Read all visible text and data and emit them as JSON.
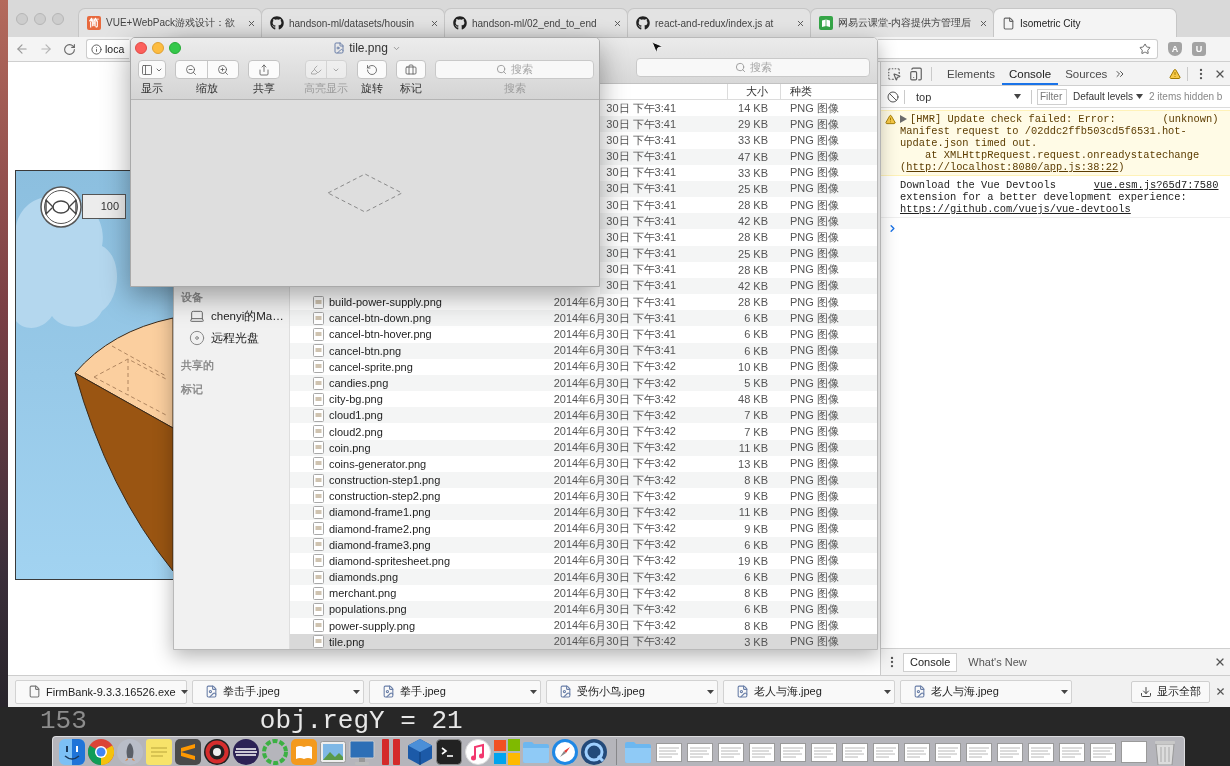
{
  "browser": {
    "tabs": [
      {
        "kind": "letter",
        "icon_text": "简",
        "title": "VUE+WebPack游戏设计：欲",
        "selected": false
      },
      {
        "kind": "github",
        "title": "handson-ml/datasets/housin",
        "selected": false
      },
      {
        "kind": "github",
        "title": "handson-ml/02_end_to_end",
        "selected": false
      },
      {
        "kind": "github",
        "title": "react-and-redux/index.js at",
        "selected": false
      },
      {
        "kind": "book",
        "title": "网易云课堂-内容提供方管理后",
        "selected": false
      },
      {
        "kind": "page",
        "title": "Isometric City",
        "selected": true
      }
    ],
    "address": {
      "value": "loca"
    },
    "extensions": [
      "A",
      "U"
    ]
  },
  "page": {
    "counter": "100"
  },
  "preview": {
    "title": "tile.png",
    "toolbar": [
      {
        "kind": "menu",
        "label": "显示",
        "disabled": false
      },
      {
        "kind": "pair",
        "label": "缩放",
        "disabled": false
      },
      {
        "kind": "button",
        "label": "共享",
        "disabled": false
      },
      {
        "kind": "split",
        "label": "高亮显示",
        "disabled": true
      },
      {
        "kind": "button",
        "label": "旋转",
        "disabled": false
      },
      {
        "kind": "button",
        "label": "标记",
        "disabled": false
      },
      {
        "kind": "search",
        "label": "搜索",
        "placeholder": "搜索",
        "disabled": false
      }
    ]
  },
  "finder": {
    "search": {
      "placeholder": "搜索"
    },
    "columns": [
      "大小",
      "种类"
    ],
    "sidebar": [
      {
        "title": "设备",
        "items": [
          {
            "kind": "computer",
            "label": "chenyi的Ma…"
          },
          {
            "kind": "disc",
            "label": "远程光盘"
          }
        ]
      },
      {
        "title": "共享的"
      },
      {
        "title": "标记"
      }
    ],
    "rows": [
      {
        "modified": "30日 下午3:41",
        "size": "14 KB",
        "type": "PNG 图像",
        "selected": false
      },
      {
        "modified": "30日 下午3:41",
        "size": "29 KB",
        "type": "PNG 图像",
        "selected": false
      },
      {
        "modified": "30日 下午3:41",
        "size": "33 KB",
        "type": "PNG 图像",
        "selected": false
      },
      {
        "modified": "30日 下午3:41",
        "size": "47 KB",
        "type": "PNG 图像",
        "selected": false
      },
      {
        "modified": "30日 下午3:41",
        "size": "33 KB",
        "type": "PNG 图像",
        "selected": false
      },
      {
        "modified": "30日 下午3:41",
        "size": "25 KB",
        "type": "PNG 图像",
        "selected": false
      },
      {
        "modified": "30日 下午3:41",
        "size": "28 KB",
        "type": "PNG 图像",
        "selected": false
      },
      {
        "modified": "30日 下午3:41",
        "size": "42 KB",
        "type": "PNG 图像",
        "selected": false
      },
      {
        "modified": "30日 下午3:41",
        "size": "28 KB",
        "type": "PNG 图像",
        "selected": false
      },
      {
        "modified": "30日 下午3:41",
        "size": "25 KB",
        "type": "PNG 图像",
        "selected": false
      },
      {
        "modified": "30日 下午3:41",
        "size": "28 KB",
        "type": "PNG 图像",
        "selected": false
      },
      {
        "modified": "30日 下午3:41",
        "size": "42 KB",
        "type": "PNG 图像",
        "selected": false
      },
      {
        "name": "build-power-supply.png",
        "modified": "2014年6月30日 下午3:41",
        "size": "28 KB",
        "type": "PNG 图像",
        "selected": false
      },
      {
        "name": "cancel-btn-down.png",
        "modified": "2014年6月30日 下午3:41",
        "size": "6 KB",
        "type": "PNG 图像",
        "selected": false
      },
      {
        "name": "cancel-btn-hover.png",
        "modified": "2014年6月30日 下午3:41",
        "size": "6 KB",
        "type": "PNG 图像",
        "selected": false
      },
      {
        "name": "cancel-btn.png",
        "modified": "2014年6月30日 下午3:41",
        "size": "6 KB",
        "type": "PNG 图像",
        "selected": false
      },
      {
        "name": "cancel-sprite.png",
        "modified": "2014年6月30日 下午3:42",
        "size": "10 KB",
        "type": "PNG 图像",
        "selected": false
      },
      {
        "name": "candies.png",
        "modified": "2014年6月30日 下午3:42",
        "size": "5 KB",
        "type": "PNG 图像",
        "selected": false
      },
      {
        "name": "city-bg.png",
        "modified": "2014年6月30日 下午3:42",
        "size": "48 KB",
        "type": "PNG 图像",
        "selected": false
      },
      {
        "name": "cloud1.png",
        "modified": "2014年6月30日 下午3:42",
        "size": "7 KB",
        "type": "PNG 图像",
        "selected": false
      },
      {
        "name": "cloud2.png",
        "modified": "2014年6月30日 下午3:42",
        "size": "7 KB",
        "type": "PNG 图像",
        "selected": false
      },
      {
        "name": "coin.png",
        "modified": "2014年6月30日 下午3:42",
        "size": "11 KB",
        "type": "PNG 图像",
        "selected": false
      },
      {
        "name": "coins-generator.png",
        "modified": "2014年6月30日 下午3:42",
        "size": "13 KB",
        "type": "PNG 图像",
        "selected": false
      },
      {
        "name": "construction-step1.png",
        "modified": "2014年6月30日 下午3:42",
        "size": "8 KB",
        "type": "PNG 图像",
        "selected": false
      },
      {
        "name": "construction-step2.png",
        "modified": "2014年6月30日 下午3:42",
        "size": "9 KB",
        "type": "PNG 图像",
        "selected": false
      },
      {
        "name": "diamond-frame1.png",
        "modified": "2014年6月30日 下午3:42",
        "size": "11 KB",
        "type": "PNG 图像",
        "selected": false
      },
      {
        "name": "diamond-frame2.png",
        "modified": "2014年6月30日 下午3:42",
        "size": "9 KB",
        "type": "PNG 图像",
        "selected": false
      },
      {
        "name": "diamond-frame3.png",
        "modified": "2014年6月30日 下午3:42",
        "size": "6 KB",
        "type": "PNG 图像",
        "selected": false
      },
      {
        "name": "diamond-spritesheet.png",
        "modified": "2014年6月30日 下午3:42",
        "size": "19 KB",
        "type": "PNG 图像",
        "selected": false
      },
      {
        "name": "diamonds.png",
        "modified": "2014年6月30日 下午3:42",
        "size": "6 KB",
        "type": "PNG 图像",
        "selected": false
      },
      {
        "name": "merchant.png",
        "modified": "2014年6月30日 下午3:42",
        "size": "8 KB",
        "type": "PNG 图像",
        "selected": false
      },
      {
        "name": "populations.png",
        "modified": "2014年6月30日 下午3:42",
        "size": "6 KB",
        "type": "PNG 图像",
        "selected": false
      },
      {
        "name": "power-supply.png",
        "modified": "2014年6月30日 下午3:42",
        "size": "8 KB",
        "type": "PNG 图像",
        "selected": false
      },
      {
        "name": "tile.png",
        "modified": "2014年6月30日 下午3:42",
        "size": "3 KB",
        "type": "PNG 图像",
        "selected": true
      }
    ]
  },
  "devtools": {
    "tabs": [
      {
        "label": "Elements",
        "selected": false
      },
      {
        "label": "Console",
        "selected": true
      },
      {
        "label": "Sources",
        "selected": false
      }
    ],
    "context": "top",
    "filter": {
      "placeholder": "Filter"
    },
    "levels": "Default levels",
    "hidden_note": "2 items hidden b",
    "messages": [
      {
        "kind": "warning",
        "expandable": true,
        "head": "[HMR] Update check failed: Error:",
        "source": "(unknown)",
        "source_link": false,
        "text": "Manifest request to /02ddc2ffb503cd5f6531.hot-update.json timed out.\n    at XMLHttpRequest.request.onreadystatechange (",
        "link": "http://localhost:8080/app.js:38:22",
        "after": ")"
      },
      {
        "kind": "log",
        "expandable": false,
        "head": "Download the Vue Devtools",
        "source": "vue.esm.js?65d7:7580",
        "source_link": true,
        "text": "extension for a better development experience:\n",
        "link": "https://github.com/vuejs/vue-devtools"
      }
    ],
    "drawer_tabs": [
      {
        "label": "Console",
        "selected": true
      },
      {
        "label": "What's New",
        "selected": false
      }
    ]
  },
  "downloads": {
    "items": [
      {
        "kind": "file",
        "name": "FirmBank-9.3.3.16526.exe"
      },
      {
        "kind": "image",
        "name": "拳击手.jpeg"
      },
      {
        "kind": "image",
        "name": "拳手.jpeg"
      },
      {
        "kind": "image",
        "name": "受伤小鸟.jpeg"
      },
      {
        "kind": "image",
        "name": "老人与海.jpeg"
      },
      {
        "kind": "image",
        "name": "老人与海.jpeg"
      }
    ],
    "show_all": "显示全部"
  },
  "editor": {
    "line_number": "153",
    "code": "obj.regY = 21"
  }
}
